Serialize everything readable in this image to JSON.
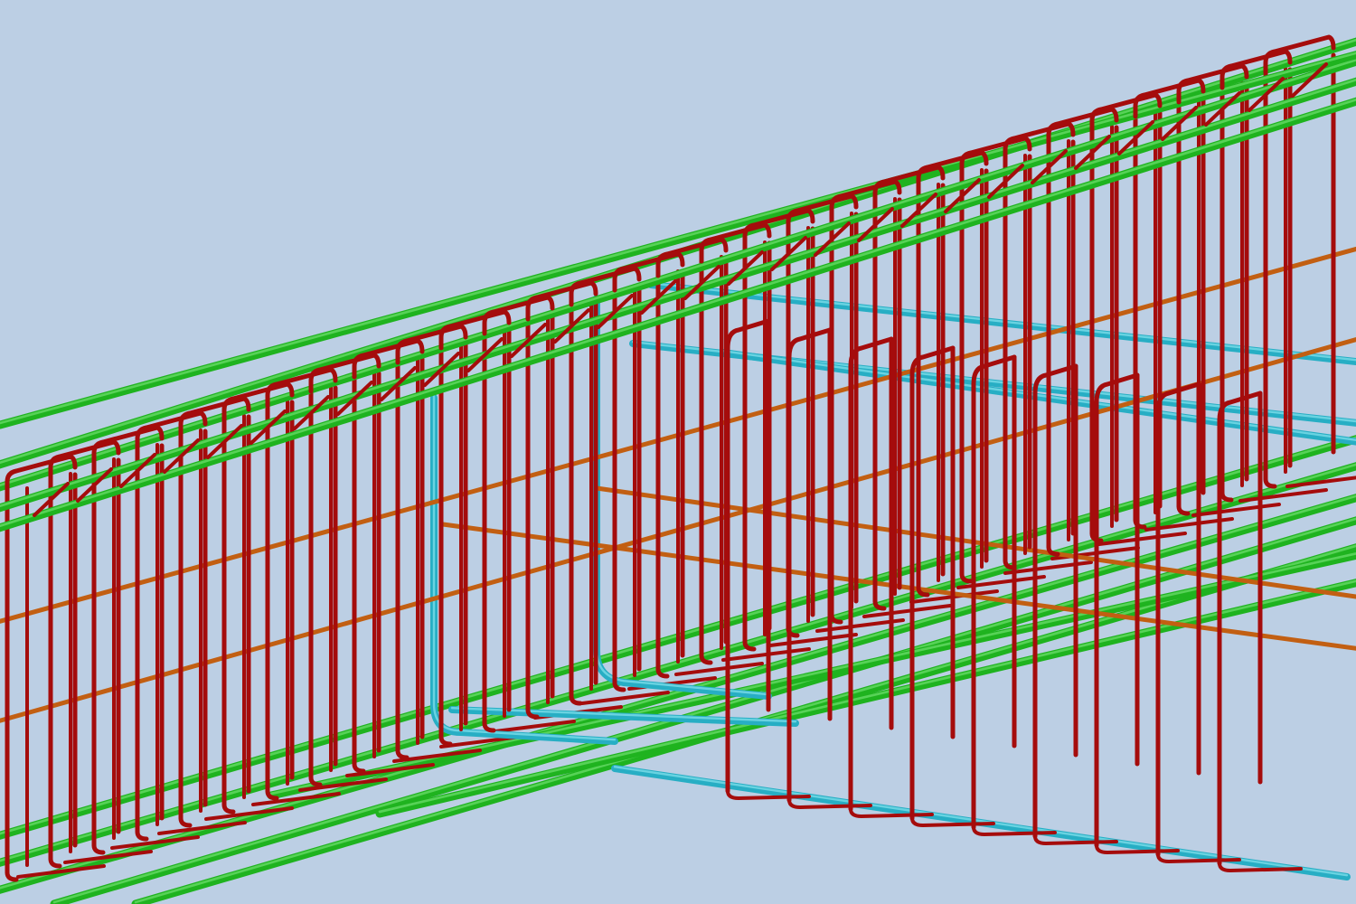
{
  "viewport": {
    "background": "#bccfe4"
  },
  "rebar_colors": {
    "longitudinal_main": "#1fb31f",
    "longitudinal_main_highlight": "#6fe06f",
    "stirrup": "#a50c0c",
    "side_bar": "#c25f12",
    "connecting_bar": "#27aec4",
    "connecting_bar_highlight": "#86e2ee"
  }
}
